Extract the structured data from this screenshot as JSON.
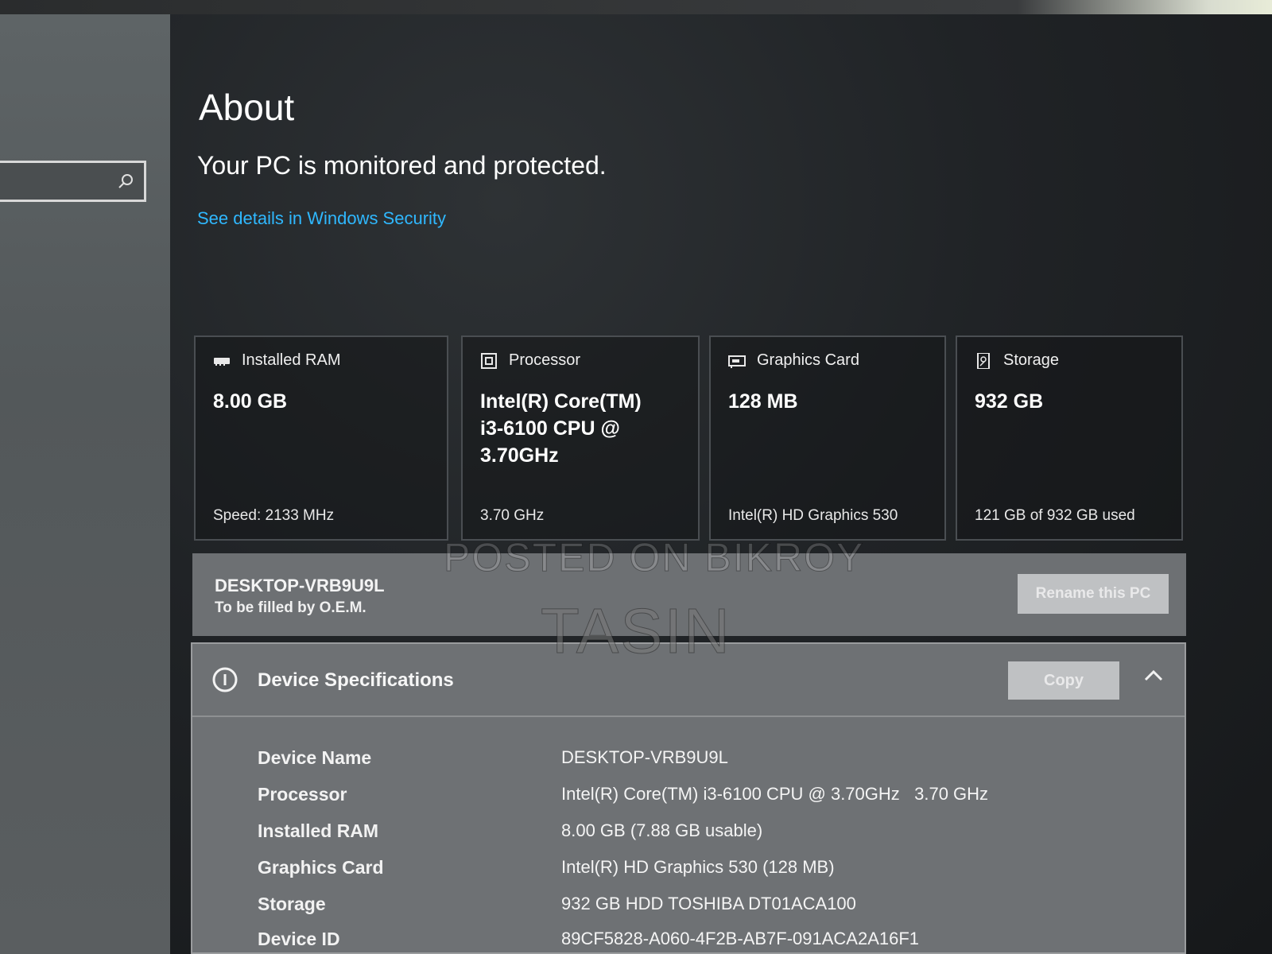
{
  "page": {
    "title": "About",
    "protection_status": "Your PC is monitored and protected.",
    "security_link": "See details in Windows Security"
  },
  "cards": {
    "ram": {
      "label": "Installed RAM",
      "value": "8.00 GB",
      "sub": "Speed: 2133 MHz"
    },
    "processor": {
      "label": "Processor",
      "value": "Intel(R) Core(TM) i3-6100 CPU @ 3.70GHz",
      "sub": "3.70 GHz"
    },
    "graphics": {
      "label": "Graphics Card",
      "value": "128 MB",
      "sub": "Intel(R) HD Graphics 530"
    },
    "storage": {
      "label": "Storage",
      "value": "932 GB",
      "sub": "121 GB of 932 GB used"
    }
  },
  "pc_name_bar": {
    "name": "DESKTOP-VRB9U9L",
    "oem": "To be filled by O.E.M.",
    "rename_label": "Rename this PC"
  },
  "specs": {
    "title": "Device Specifications",
    "copy_label": "Copy",
    "rows": [
      {
        "label": "Device Name",
        "value": "DESKTOP-VRB9U9L"
      },
      {
        "label": "Processor",
        "value": "Intel(R) Core(TM) i3-6100 CPU @ 3.70GHz   3.70 GHz"
      },
      {
        "label": "Installed RAM",
        "value": "8.00 GB (7.88 GB usable)"
      },
      {
        "label": "Graphics Card",
        "value": "Intel(R) HD Graphics 530 (128 MB)"
      },
      {
        "label": "Storage",
        "value": "932 GB HDD TOSHIBA DT01ACA100"
      },
      {
        "label": "Device ID",
        "value": "89CF5828-A060-4F2B-AB7F-091ACA2A16F1"
      }
    ]
  },
  "watermarks": {
    "line1": "POSTED ON BIKROY",
    "line2": "TASIN"
  },
  "icons": {
    "search": "search-icon",
    "ram": "ram-icon",
    "processor": "processor-icon",
    "graphics": "graphics-card-icon",
    "storage": "storage-icon",
    "info": "info-icon",
    "collapse": "chevron-up-icon"
  },
  "colors": {
    "link": "#2fb8ff",
    "panel": "#6e7174",
    "button": "#bfc1c3"
  }
}
